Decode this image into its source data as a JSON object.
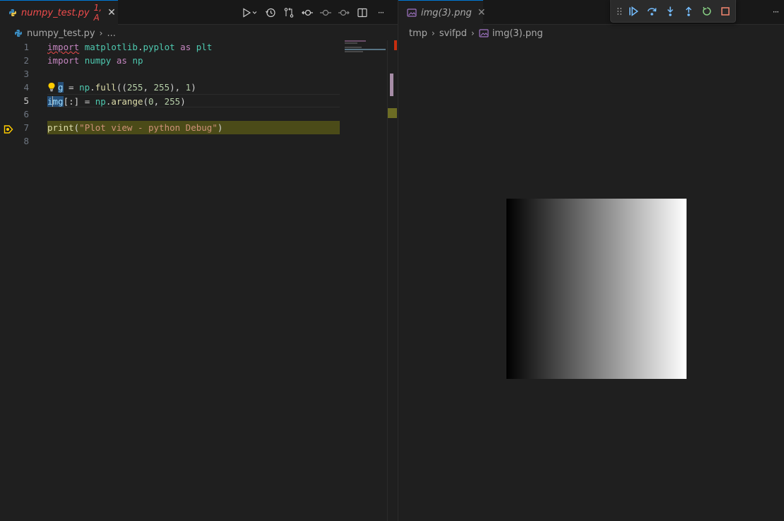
{
  "left_tab": {
    "filename": "numpy_test.py",
    "problems": "1, A",
    "close": "✕"
  },
  "left_breadcrumb": {
    "file": "numpy_test.py",
    "ellipsis": "..."
  },
  "line_numbers": [
    "1",
    "2",
    "3",
    "4",
    "5",
    "6",
    "7",
    "8"
  ],
  "code": {
    "l1": [
      "import",
      "matplotlib",
      ".",
      "pyplot",
      "as",
      "plt"
    ],
    "l2": [
      "import",
      "numpy",
      "as",
      "np"
    ],
    "l4": [
      "g",
      " = ",
      "np",
      ".",
      "full",
      "((",
      "255",
      ", ",
      "255",
      "), ",
      "1",
      ")"
    ],
    "l5": [
      "i",
      "mg",
      "[:] = ",
      "np",
      ".",
      "arange",
      "(",
      "0",
      ", ",
      "255",
      ")"
    ],
    "l7": [
      "print",
      "(",
      "\"Plot view - python Debug\"",
      ")"
    ]
  },
  "current_line": "5",
  "stopped_line": "7",
  "right_tab": {
    "filename": "img(3).png",
    "close": "✕"
  },
  "right_breadcrumb": {
    "folder1": "tmp",
    "folder2": "svifpd",
    "file": "img(3).png"
  },
  "more_actions": "···",
  "icons": {
    "python_file": "python-file-icon",
    "image_file": "image-file-icon",
    "run": "run-icon",
    "timeline": "timeline-icon",
    "compare": "compare-changes-icon",
    "split": "split-editor-icon",
    "continue": "continue-icon",
    "step_over": "step-over-icon",
    "step_into": "step-into-icon",
    "step_out": "step-out-icon",
    "restart": "restart-icon",
    "stop": "stop-icon"
  },
  "colors": {
    "accent": "#0078d4",
    "debug_blue": "#75beff",
    "restart_green": "#89d185",
    "stop_red": "#f48771",
    "tab_modified": "#f14c4c",
    "stopped_line_bg": "#4b4b18"
  }
}
